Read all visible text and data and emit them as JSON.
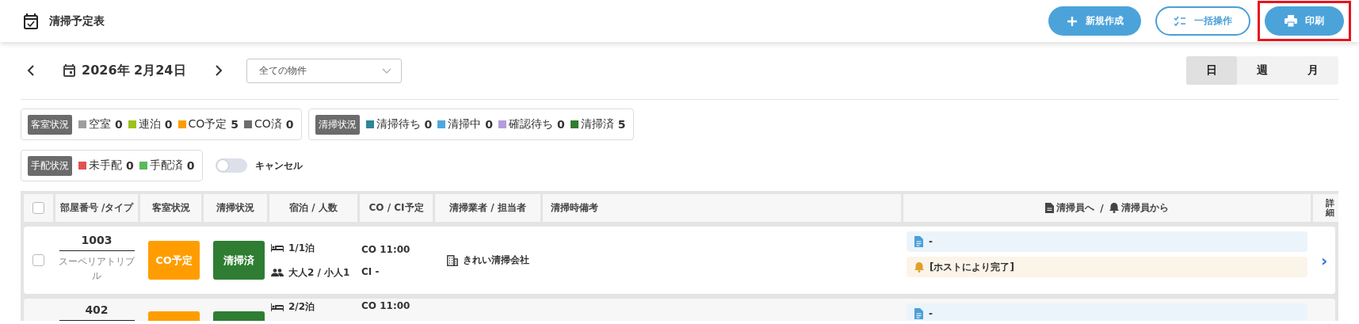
{
  "header": {
    "title": "清掃予定表",
    "buttons": [
      {
        "label": "新規作成",
        "kind": "add",
        "highlighted": false
      },
      {
        "label": "一括操作",
        "kind": "bulk",
        "highlighted": false
      },
      {
        "label": "印刷",
        "kind": "print",
        "highlighted": true
      }
    ]
  },
  "toolbar": {
    "date": "2026年 2月24日",
    "property_select": {
      "value": "全ての物件"
    },
    "view_tabs": [
      {
        "label": "日",
        "selected": true
      },
      {
        "label": "週",
        "selected": false
      },
      {
        "label": "月",
        "selected": false
      }
    ]
  },
  "legends": [
    {
      "title": "客室状況",
      "items": [
        {
          "label": "空室",
          "count": "0",
          "color": "#9e9e9e"
        },
        {
          "label": "連泊",
          "count": "0",
          "color": "#9bc31b"
        },
        {
          "label": "CO予定",
          "count": "5",
          "color": "#ff9d00"
        },
        {
          "label": "CO済",
          "count": "0",
          "color": "#6e6e6e"
        }
      ]
    },
    {
      "title": "清掃状況",
      "items": [
        {
          "label": "清掃待ち",
          "count": "0",
          "color": "#2f8696"
        },
        {
          "label": "清掃中",
          "count": "0",
          "color": "#4ba8de"
        },
        {
          "label": "確認待ち",
          "count": "0",
          "color": "#b39ddb"
        },
        {
          "label": "清掃済",
          "count": "5",
          "color": "#2e7d32"
        }
      ]
    },
    {
      "title": "手配状況",
      "items": [
        {
          "label": "未手配",
          "count": "0",
          "color": "#e05252"
        },
        {
          "label": "手配済",
          "count": "0",
          "color": "#5cb85c"
        }
      ]
    }
  ],
  "cancel_toggle": {
    "label": "キャンセル",
    "on": false
  },
  "table": {
    "select_all": {
      "checked": false
    },
    "columns": [
      "部屋番号 /タイプ",
      "客室状況",
      "清掃状況",
      "宿泊 / 人数",
      "CO / CI予定",
      "清掃業者 / 担当者",
      "清掃時備考",
      "清掃員へ",
      "/",
      "清掃員から",
      "詳細"
    ],
    "rows": [
      {
        "checked": false,
        "room": "1003",
        "room_type": "スーペリアトリプル",
        "room_status": {
          "label": "CO予定",
          "color": "#ff9d00"
        },
        "clean_status": {
          "label": "清掃済",
          "color": "#2e7d32"
        },
        "nights": "1/1泊",
        "guests": "大人2 / 小人1",
        "checkout": "CO 11:00",
        "checkin": "CI -",
        "cleaner": "きれい清掃会社",
        "note_to": "-",
        "note_from": "[ホストにより完了]",
        "detail": "›"
      },
      {
        "room": "402",
        "room_status": {
          "color": "#ff9d00"
        },
        "clean_status": {
          "color": "#2e7d32"
        },
        "nights": "2/2泊",
        "checkout": "CO 11:00",
        "note_to": "-"
      }
    ]
  }
}
